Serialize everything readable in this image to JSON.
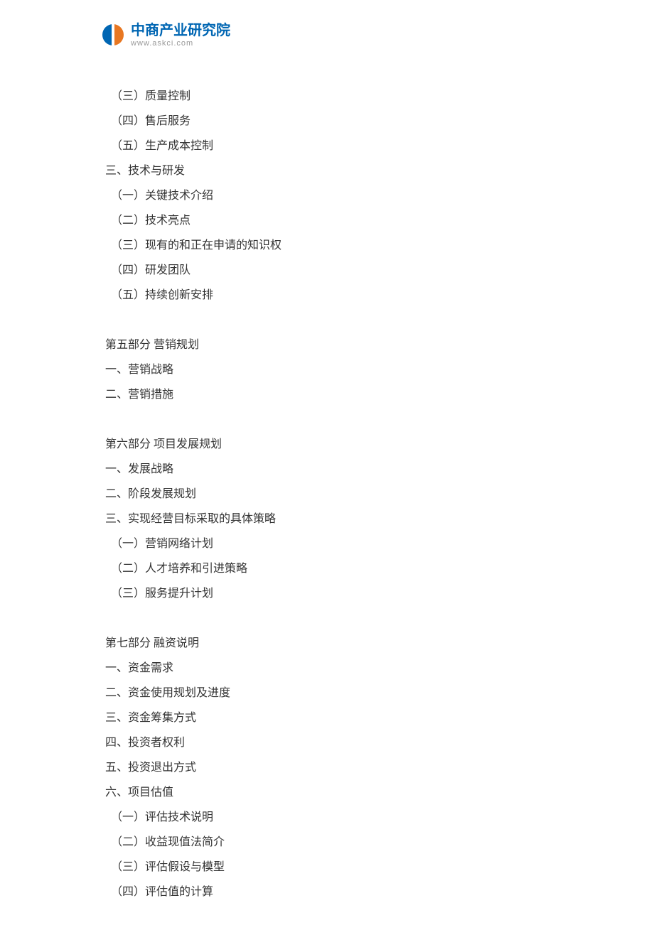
{
  "logo": {
    "title": "中商产业研究院",
    "url": "www.askci.com"
  },
  "lines": [
    {
      "text": "（三）质量控制",
      "indent": true,
      "section": false
    },
    {
      "text": "（四）售后服务",
      "indent": true,
      "section": false
    },
    {
      "text": "（五）生产成本控制",
      "indent": true,
      "section": false
    },
    {
      "text": "三、技术与研发",
      "indent": false,
      "section": false
    },
    {
      "text": "（一）关键技术介绍",
      "indent": true,
      "section": false
    },
    {
      "text": "（二）技术亮点",
      "indent": true,
      "section": false
    },
    {
      "text": "（三）现有的和正在申请的知识权",
      "indent": true,
      "section": false
    },
    {
      "text": "（四）研发团队",
      "indent": true,
      "section": false
    },
    {
      "text": "（五）持续创新安排",
      "indent": true,
      "section": false
    },
    {
      "text": "第五部分  营销规划",
      "indent": false,
      "section": true
    },
    {
      "text": "一、营销战略",
      "indent": false,
      "section": false
    },
    {
      "text": "二、营销措施",
      "indent": false,
      "section": false
    },
    {
      "text": "第六部分  项目发展规划",
      "indent": false,
      "section": true
    },
    {
      "text": "一、发展战略",
      "indent": false,
      "section": false
    },
    {
      "text": "二、阶段发展规划",
      "indent": false,
      "section": false
    },
    {
      "text": "三、实现经营目标采取的具体策略",
      "indent": false,
      "section": false
    },
    {
      "text": "（一）营销网络计划",
      "indent": true,
      "section": false
    },
    {
      "text": "（二）人才培养和引进策略",
      "indent": true,
      "section": false
    },
    {
      "text": "（三）服务提升计划",
      "indent": true,
      "section": false
    },
    {
      "text": "第七部分  融资说明",
      "indent": false,
      "section": true
    },
    {
      "text": "一、资金需求",
      "indent": false,
      "section": false
    },
    {
      "text": "二、资金使用规划及进度",
      "indent": false,
      "section": false
    },
    {
      "text": "三、资金筹集方式",
      "indent": false,
      "section": false
    },
    {
      "text": "四、投资者权利",
      "indent": false,
      "section": false
    },
    {
      "text": "五、投资退出方式",
      "indent": false,
      "section": false
    },
    {
      "text": "六、项目估值",
      "indent": false,
      "section": false
    },
    {
      "text": "（一）评估技术说明",
      "indent": true,
      "section": false
    },
    {
      "text": "（二）收益现值法简介",
      "indent": true,
      "section": false
    },
    {
      "text": "（三）评估假设与模型",
      "indent": true,
      "section": false
    },
    {
      "text": "（四）评估值的计算",
      "indent": true,
      "section": false
    }
  ]
}
